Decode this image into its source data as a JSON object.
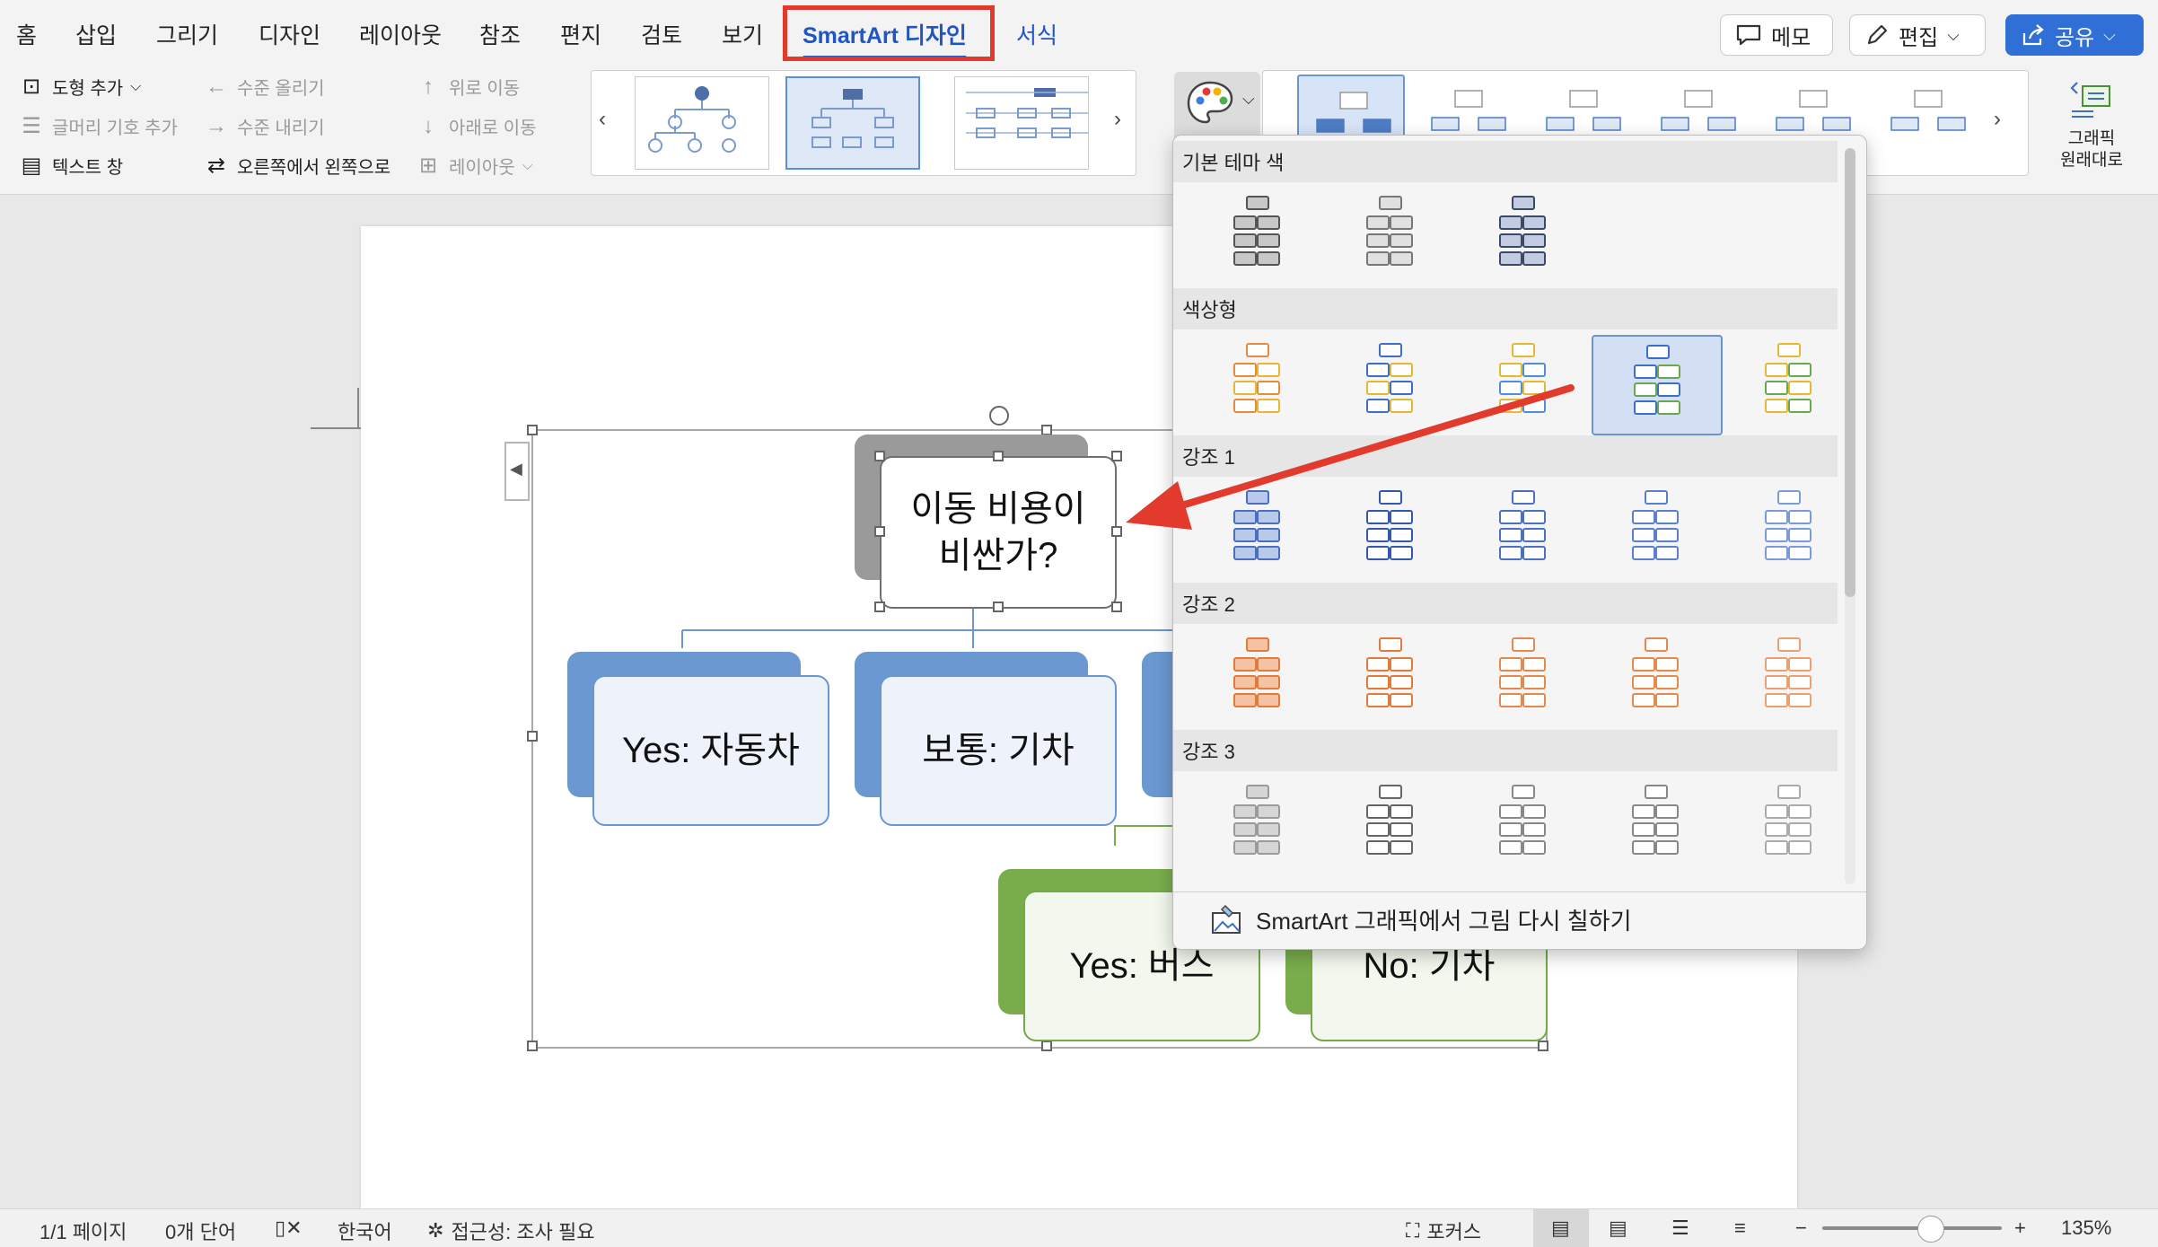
{
  "tabs": [
    "홈",
    "삽입",
    "그리기",
    "디자인",
    "레이아웃",
    "참조",
    "편지",
    "검토",
    "보기",
    "SmartArt 디자인",
    "서식"
  ],
  "top_buttons": {
    "comment": "메모",
    "edit": "편집",
    "share": "공유"
  },
  "ribbon": {
    "add_shape": "도형 추가",
    "add_bullet": "글머리 기호 추가",
    "text_pane": "텍스트 창",
    "promote": "수준 올리기",
    "demote": "수준 내리기",
    "right_to_left": "오른쪽에서 왼쪽으로",
    "move_up": "위로 이동",
    "move_down": "아래로 이동",
    "layout": "레이아웃",
    "reset_graphic_line1": "그래픽",
    "reset_graphic_line2": "원래대로"
  },
  "smartart": {
    "root": "이동 비용이 비싼가?",
    "children": [
      "Yes: 자동차",
      "보통: 기차"
    ],
    "grandchildren": [
      "Yes: 버스",
      "No: 기차"
    ]
  },
  "color_dropdown": {
    "sections": [
      "기본 테마 색",
      "색상형",
      "강조 1",
      "강조 2",
      "강조 3"
    ],
    "recolor_label": "SmartArt 그래픽에서 그림 다시 칠하기"
  },
  "status": {
    "page": "1/1 페이지",
    "words": "0개 단어",
    "language": "한국어",
    "accessibility": "접근성: 조사 필요",
    "focus": "포커스",
    "zoom": "135%",
    "zoom_level": 0.6
  },
  "colors": {
    "accent": "#2155c4",
    "highlight_red": "#e03a2f",
    "blue_node": "#6b98d0",
    "green_node": "#79ad4c",
    "grey_node": "#9a9a9a"
  }
}
